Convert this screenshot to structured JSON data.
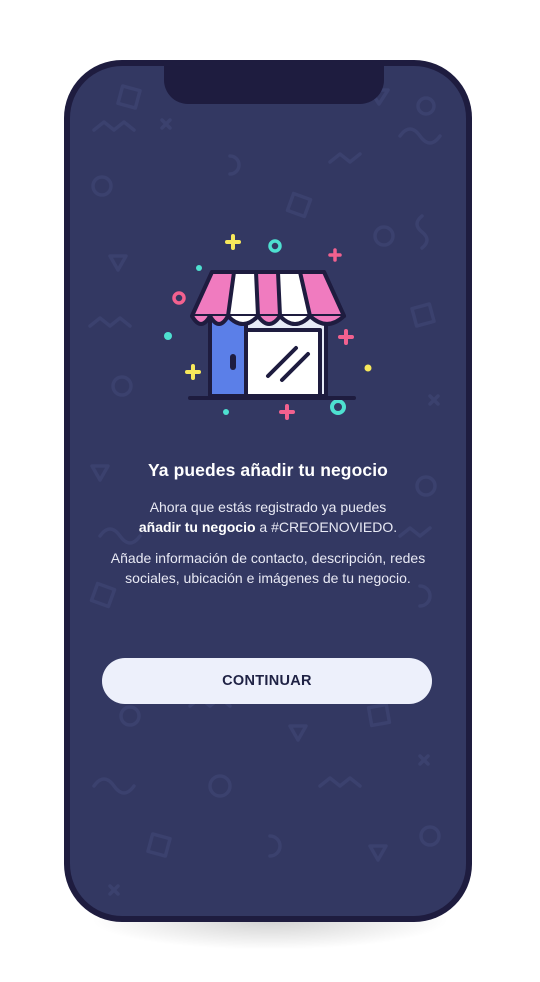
{
  "onboarding": {
    "title": "Ya puedes añadir tu negocio",
    "paragraph1_start": "Ahora que estás registrado ya puedes",
    "paragraph1_bold": "añadir tu negocio",
    "paragraph1_end": " a #CREOENOVIEDO.",
    "paragraph2": "Añade información de contacto, descripción, redes sociales, ubicación e imágenes de tu negocio.",
    "cta_label": "CONTINUAR",
    "illustration_icon": "shop-storefront-icon"
  },
  "colors": {
    "background": "#333862",
    "bezel": "#1e1c3f",
    "awning_pink": "#f07bbf",
    "door_blue": "#5b7fe8",
    "confetti_yellow": "#f7e85b",
    "confetti_teal": "#4ee0d0",
    "confetti_pink": "#f2618f",
    "button_bg": "#edf0fb"
  }
}
